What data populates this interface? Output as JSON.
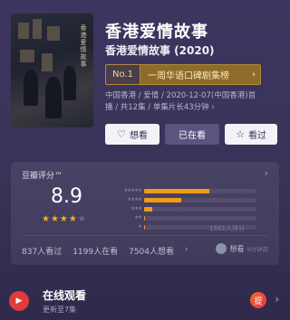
{
  "title": "香港爱情故事",
  "subtitle": "香港爱情故事 (2020)",
  "poster_text": "香港爱情故事",
  "rank": {
    "no": "No.1",
    "label": "一周华语口碑剧集榜",
    "chevron": "›"
  },
  "meta_line1": "中国香港 / 爱情 / 2020-12-07(中国香港)首",
  "meta_line2": "播 / 共12集 / 单集片长43分钟",
  "meta_chevron": "›",
  "buttons": {
    "want_label": "想看",
    "have_label": "已在看",
    "watched_label": "看过"
  },
  "rating": {
    "heading": "豆瓣评分™",
    "score": "8.9",
    "stars": "★★★★",
    "half_star": "★",
    "total": "1561人评分",
    "distribution": [
      {
        "stars": "★★★★★",
        "fraction": 0.58
      },
      {
        "stars": "★★★★",
        "fraction": 0.33
      },
      {
        "stars": "★★★",
        "fraction": 0.07
      },
      {
        "stars": "★★",
        "fraction": 0.01
      },
      {
        "stars": "★",
        "fraction": 0.01
      }
    ],
    "watched_count": "837人看过",
    "watching_count": "1199人在看",
    "want_count": "7504人想看",
    "friend_action": "想看",
    "friend_time": "9分钟前"
  },
  "online": {
    "title": "在线观看",
    "subtitle": "更新至7集",
    "provider_icon": "提"
  },
  "colors": {
    "accent": "#f09a15",
    "rank_gold": "#8e6a2b",
    "play_red": "#e23b3b"
  }
}
